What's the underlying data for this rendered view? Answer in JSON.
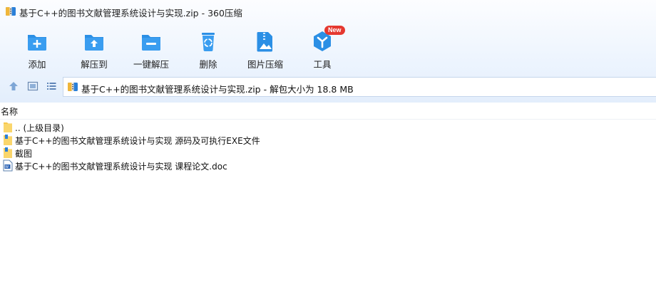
{
  "window": {
    "title": "基于C++的图书文献管理系统设计与实现.zip - 360压缩"
  },
  "toolbar": {
    "items": [
      {
        "label": "添加",
        "icon": "add-folder-icon"
      },
      {
        "label": "解压到",
        "icon": "extract-to-icon"
      },
      {
        "label": "一键解压",
        "icon": "one-click-extract-icon"
      },
      {
        "label": "删除",
        "icon": "recycle-bin-icon"
      },
      {
        "label": "图片压缩",
        "icon": "image-compress-icon"
      },
      {
        "label": "工具",
        "icon": "tools-icon",
        "badge": "New"
      }
    ]
  },
  "address_bar": {
    "path": "基于C++的图书文献管理系统设计与实现.zip - 解包大小为 18.8 MB"
  },
  "file_list": {
    "column_name": "名称",
    "items": [
      {
        "name": ".. (上级目录)",
        "type": "folder"
      },
      {
        "name": "基于C++的图书文献管理系统设计与实现 源码及可执行EXE文件",
        "type": "folder"
      },
      {
        "name": "截图",
        "type": "folder"
      },
      {
        "name": "基于C++的图书文献管理系统设计与实现 课程论文.doc",
        "type": "doc"
      }
    ]
  },
  "colors": {
    "accent": "#2b8fe5",
    "badge": "#e5382f",
    "folder": "#f7c84d"
  }
}
